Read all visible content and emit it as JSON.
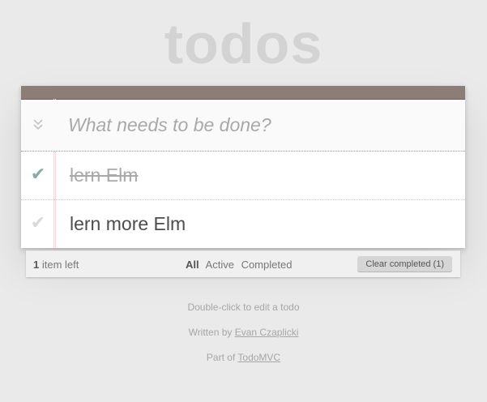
{
  "app_title": "todos",
  "new_todo": {
    "placeholder": "What needs to be done?",
    "toggle_all_icon": "double-chevron-down-icon"
  },
  "todos": [
    {
      "label": "lern Elm",
      "completed": true
    },
    {
      "label": "lern more Elm",
      "completed": false
    }
  ],
  "footer": {
    "count": "1",
    "count_suffix": " item left",
    "filters": [
      "All",
      "Active",
      "Completed"
    ],
    "selected_filter": "All",
    "clear_completed_label": "Clear completed (1)"
  },
  "info": {
    "edit_hint": "Double-click to edit a todo",
    "written_by_prefix": "Written by ",
    "author": "Evan Czaplicki",
    "part_of_prefix": "Part of ",
    "part_of_link": "TodoMVC"
  },
  "colors": {
    "header_bar": "#8d7d77",
    "check_done": "#85ada7",
    "check_undone": "#d9d9d9",
    "title": "#d3d3d3"
  }
}
